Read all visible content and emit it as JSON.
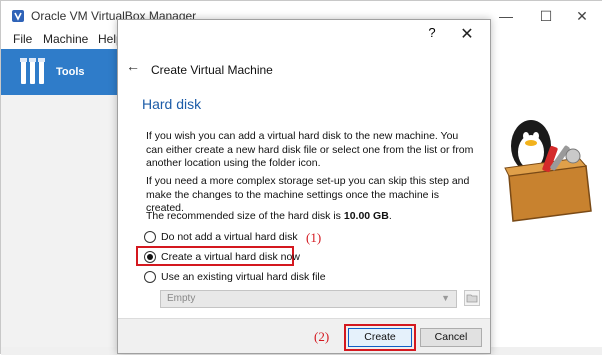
{
  "main_window": {
    "title": "Oracle VM VirtualBox Manager",
    "minimize_glyph": "—",
    "maximize_glyph": "☐",
    "close_glyph": "✕",
    "menu": {
      "file": "File",
      "machine": "Machine",
      "help": "Help"
    },
    "sidebar": {
      "tools_label": "Tools"
    }
  },
  "dialog": {
    "help_glyph": "?",
    "close_glyph": "✕",
    "back_glyph": "←",
    "title": "Create Virtual Machine",
    "section_title": "Hard disk",
    "paragraph_1": "If you wish you can add a virtual hard disk to the new machine. You can either create a new hard disk file or select one from the list or from another location using the folder icon.",
    "paragraph_2": "If you need a more complex storage set-up you can skip this step and make the changes to the machine settings once the machine is created.",
    "recommend_prefix": "The recommended size of the hard disk is ",
    "recommend_size": "10.00 GB",
    "recommend_suffix": ".",
    "options": [
      {
        "label": "Do not add a virtual hard disk",
        "selected": false
      },
      {
        "label": "Create a virtual hard disk now",
        "selected": true
      },
      {
        "label": "Use an existing virtual hard disk file",
        "selected": false
      }
    ],
    "disk_select": {
      "value": "Empty",
      "arrow": "▼"
    },
    "annotation_1": "(1)",
    "annotation_2": "(2)",
    "buttons": {
      "create": "Create",
      "cancel": "Cancel"
    }
  },
  "colors": {
    "accent_blue": "#2f7cc9",
    "section_title": "#1c5ca8",
    "annotation_red": "#d4181f"
  }
}
